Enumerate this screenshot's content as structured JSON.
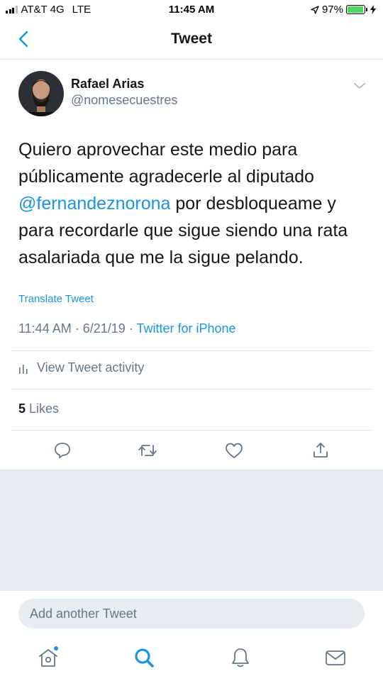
{
  "status_bar": {
    "carrier": "AT&T 4G",
    "network": "LTE",
    "time": "11:45 AM",
    "battery_percent": "97%",
    "battery_level": 0.97,
    "icons": [
      "signal-icon",
      "location-arrow-icon",
      "battery-icon",
      "charging-bolt-icon"
    ]
  },
  "nav": {
    "title": "Tweet",
    "back_icon": "back-chevron-icon"
  },
  "tweet": {
    "author_name": "Rafael Arias",
    "author_handle": "@nomesecuestres",
    "text_before": "Quiero aprovechar este medio para públicamente agradecerle al diputado ",
    "mention": "@fernandeznorona",
    "text_after": " por desbloqueame y para recordarle que sigue siendo una rata asalariada que me la sigue pelando.",
    "translate_label": "Translate Tweet",
    "timestamp": "11:44 AM · 6/21/19 · ",
    "source": "Twitter for iPhone",
    "activity_label": "View Tweet activity",
    "likes_count": "5",
    "likes_label": " Likes"
  },
  "actions": [
    "reply-icon",
    "retweet-icon",
    "like-icon",
    "share-icon"
  ],
  "compose": {
    "placeholder": "Add another Tweet"
  },
  "tabs": [
    "home-icon",
    "search-icon",
    "notifications-icon",
    "messages-icon"
  ],
  "colors": {
    "accent": "#1b95e0",
    "text": "#14171a",
    "muted": "#657786",
    "divider": "#e1e8ed",
    "panel": "#e6ecf0",
    "battery": "#4cd964"
  }
}
